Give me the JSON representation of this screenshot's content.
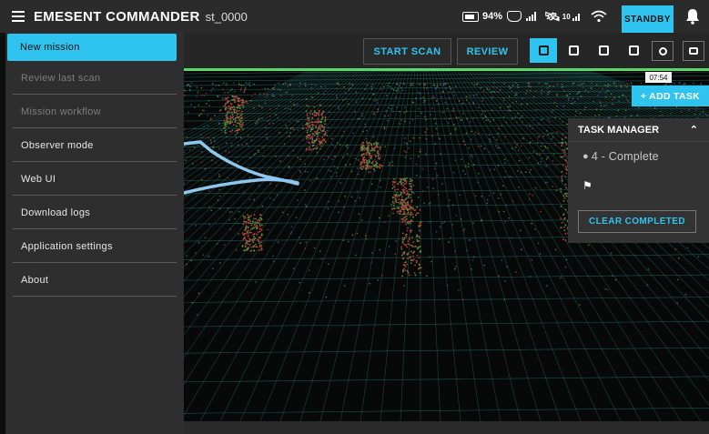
{
  "header": {
    "title": "EMESENT COMMANDER",
    "scan_id": "st_0000",
    "battery": "94%",
    "satellites": "10",
    "mode": "STANDBY",
    "accent": "#2fc4f0"
  },
  "sidebar": {
    "items": [
      {
        "label": "New mission",
        "state": "active"
      },
      {
        "label": "Review last scan",
        "state": "disabled"
      },
      {
        "label": "Mission workflow",
        "state": "disabled"
      },
      {
        "label": "Observer mode",
        "state": "normal"
      },
      {
        "label": "Web UI",
        "state": "normal"
      },
      {
        "label": "Download logs",
        "state": "normal"
      },
      {
        "label": "Application settings",
        "state": "normal"
      },
      {
        "label": "About",
        "state": "normal"
      }
    ]
  },
  "toolbar": {
    "start_scan": "START SCAN",
    "review": "REVIEW",
    "view_icons": [
      "perspective-view-icon",
      "front-view-icon",
      "side-view-icon",
      "top-view-icon",
      "recenter-icon",
      "chat-icon"
    ],
    "active_view": 0,
    "highlight_color": "#5fd66a"
  },
  "viewport": {
    "elapsed_time": "07:54",
    "add_task_label": "+ ADD TASK"
  },
  "task_manager": {
    "title": "TASK MANAGER",
    "status": "4 - Complete",
    "clear_label": "CLEAR COMPLETED"
  }
}
